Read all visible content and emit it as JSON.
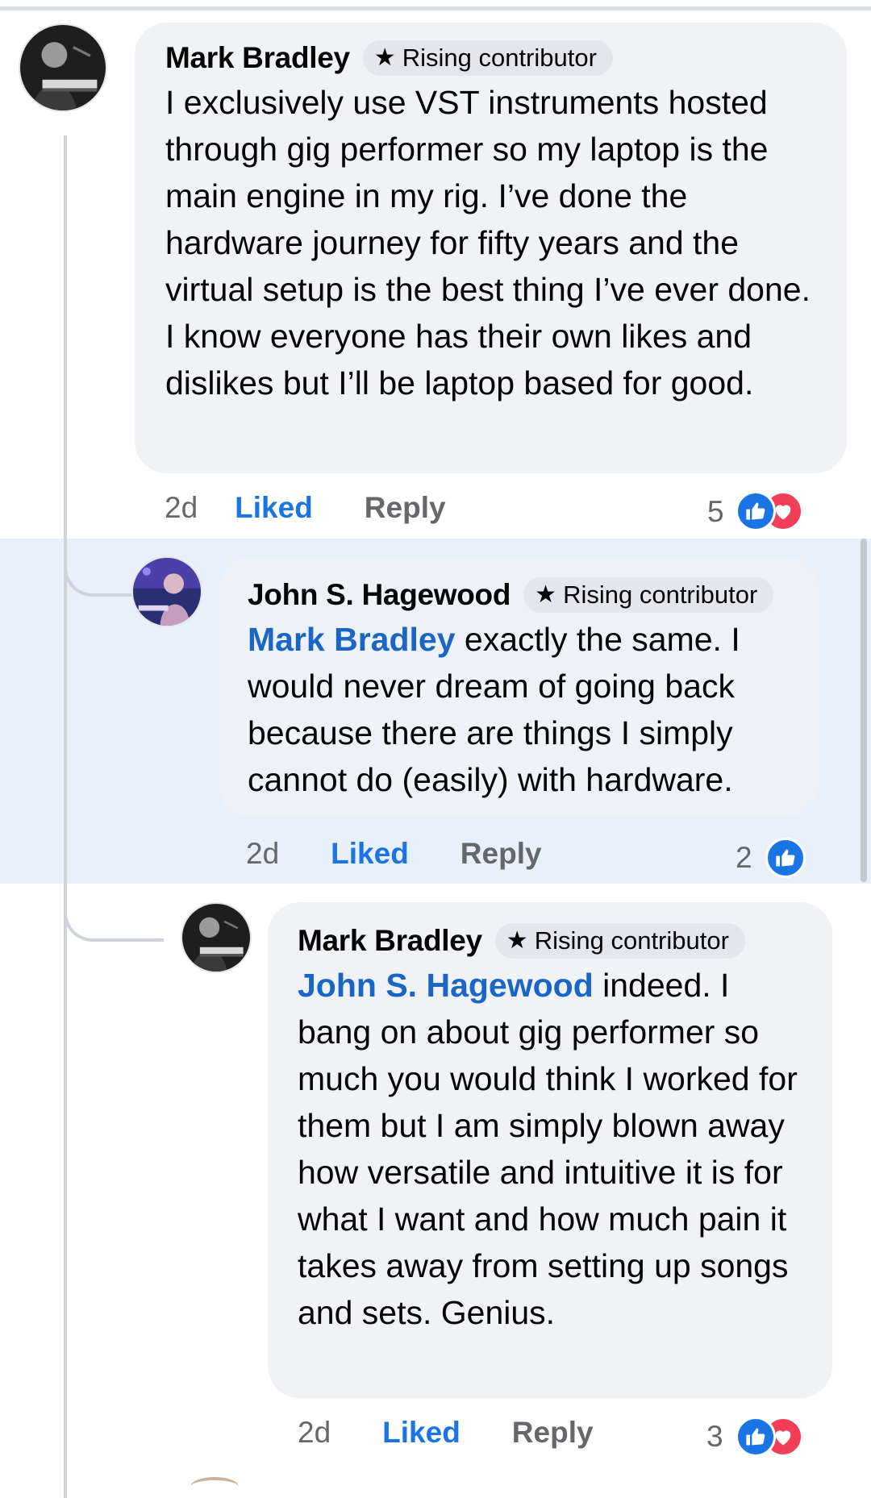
{
  "comments": [
    {
      "author": "Mark Bradley",
      "badge": "Rising contributor",
      "mention": "",
      "text": "I exclusively use VST instruments hosted through gig performer so my laptop is the main engine in my rig. I’ve done the hardware journey for fifty years and the virtual setup is the best thing I’ve ever done. I know everyone has their own likes and dislikes but I’ll be laptop based for good.",
      "time": "2d",
      "liked_label": "Liked",
      "reply_label": "Reply",
      "reaction_count": "5",
      "reactions": [
        "like-icon",
        "love-icon"
      ]
    },
    {
      "author": "John S. Hagewood",
      "badge": "Rising contributor",
      "mention": "Mark Bradley",
      "text": " exactly the same. I would never dream of going back because there are things I simply cannot do (easily) with hardware.",
      "time": "2d",
      "liked_label": "Liked",
      "reply_label": "Reply",
      "reaction_count": "2",
      "reactions": [
        "like-icon"
      ]
    },
    {
      "author": "Mark Bradley",
      "badge": "Rising contributor",
      "mention": "John S. Hagewood",
      "text": " indeed. I bang on about gig performer so much you would think I worked for them but I am simply blown away how versatile and intuitive it is for what I want and how much pain it takes away from setting up songs and sets. Genius.",
      "time": "2d",
      "liked_label": "Liked",
      "reply_label": "Reply",
      "reaction_count": "3",
      "reactions": [
        "like-icon",
        "love-icon"
      ]
    }
  ],
  "colors": {
    "mention": "#1966c6",
    "liked": "#1b74e4",
    "highlight": "#e7f0fb",
    "bubble": "#f0f2f5",
    "love": "#f33e58"
  }
}
